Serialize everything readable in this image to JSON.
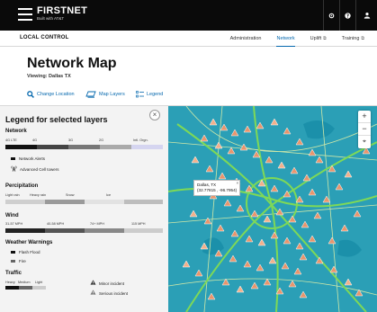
{
  "brand": {
    "name": "FIRSTNET",
    "tagline": "Built with AT&T"
  },
  "topbar": {
    "icons": [
      "settings-icon",
      "help-icon",
      "account-icon"
    ]
  },
  "nav": {
    "section": "LOCAL CONTROL",
    "links": [
      {
        "label": "Administration",
        "active": false,
        "external": false
      },
      {
        "label": "Network",
        "active": true,
        "external": false
      },
      {
        "label": "Uplift",
        "active": false,
        "external": true
      },
      {
        "label": "Training",
        "active": false,
        "external": true
      }
    ],
    "external_glyph": "⧉"
  },
  "page": {
    "title": "Network Map",
    "viewing": "Viewing: Dallas TX"
  },
  "toolbar": {
    "change_location": "Change Location",
    "map_layers": "Map Layers",
    "legend": "Legend"
  },
  "legend": {
    "title": "Legend for selected layers",
    "close": "×",
    "network": {
      "label": "Network",
      "ticks": [
        "4G LTE",
        "4G",
        "3G",
        "2G",
        "Intl. Orgn."
      ],
      "colors": [
        "#111111",
        "#444444",
        "#777777",
        "#aaaaaa",
        "#d5d5f0"
      ],
      "alerts": "Network Alerts",
      "cell_towers": "Advanced Cell towers"
    },
    "precipitation": {
      "label": "Percipitation",
      "ticks": [
        "Light rain",
        "Heavy rain",
        "Snow",
        "Ice"
      ],
      "colors": [
        "#cfcfcf",
        "#9a9a9a",
        "#e2e2e2",
        "#bdbdbd"
      ]
    },
    "wind": {
      "label": "Wind",
      "ticks": [
        "31-57 MPH",
        "40-58 MPH",
        "74+ MPH",
        "115 MPH"
      ],
      "colors": [
        "#222222",
        "#555555",
        "#888888",
        "#cccccc"
      ]
    },
    "weather_warnings": {
      "label": "Weather Warnings",
      "items": [
        {
          "label": "Flash Flood",
          "color": "#111111"
        },
        {
          "label": "Fire",
          "color": "#666666"
        }
      ]
    },
    "traffic": {
      "label": "Traffic",
      "ticks": [
        "Heavy",
        "Medium",
        "Light"
      ],
      "colors": [
        "#111111",
        "#666666",
        "#cccccc"
      ],
      "minor": "Minor incident",
      "serious": "Serious incident"
    }
  },
  "map": {
    "popup_title": "Dallas, TX",
    "popup_coords": "(32.77815 , -96.7954)",
    "popup_close": "×",
    "zoom_in": "+",
    "zoom_out": "−",
    "locate": "⌖",
    "colors": {
      "water": "#1a8ea8",
      "land": "#2b9fb6",
      "road_major": "#7ed957",
      "road_minor": "#cfe8a8",
      "marker": "#e8956d"
    }
  },
  "accent": "#0568ae"
}
